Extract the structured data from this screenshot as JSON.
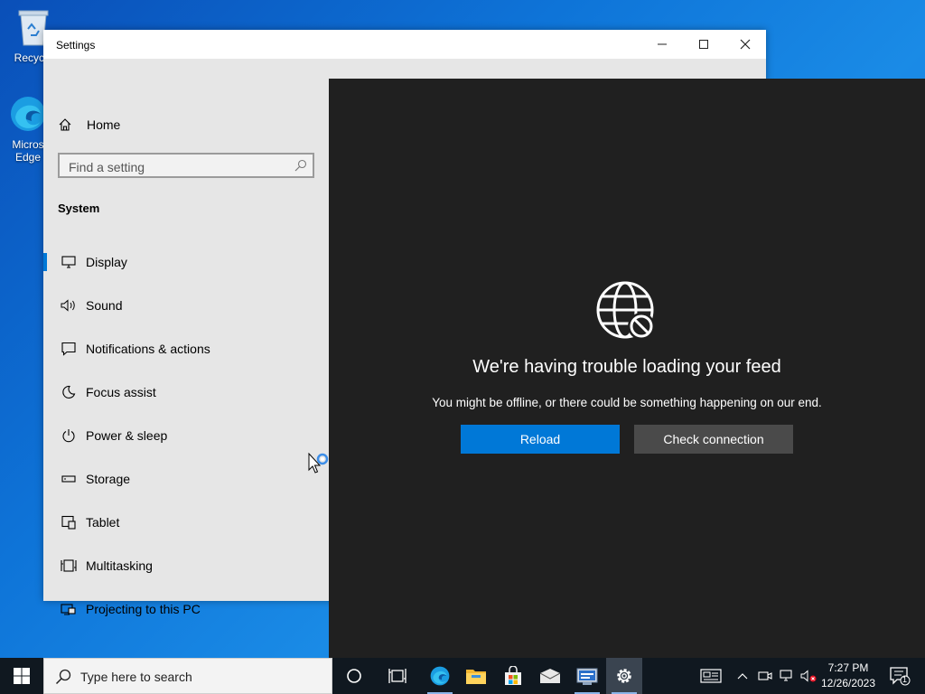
{
  "desktop": {
    "icons": [
      {
        "label": "Recycle"
      },
      {
        "label": "Microsoft Edge",
        "label_line1": "Micros",
        "label_line2": "Edge"
      }
    ]
  },
  "window": {
    "title": "Settings",
    "controls": {
      "minimize": "minimize-icon",
      "maximize": "maximize-icon",
      "close": "close-icon"
    }
  },
  "sidebar": {
    "home_label": "Home",
    "search_placeholder": "Find a setting",
    "section_title": "System",
    "items": [
      {
        "label": "Display",
        "icon": "display-icon",
        "active": true
      },
      {
        "label": "Sound",
        "icon": "sound-icon"
      },
      {
        "label": "Notifications & actions",
        "icon": "notifications-icon"
      },
      {
        "label": "Focus assist",
        "icon": "moon-icon"
      },
      {
        "label": "Power & sleep",
        "icon": "power-icon"
      },
      {
        "label": "Storage",
        "icon": "storage-icon"
      },
      {
        "label": "Tablet",
        "icon": "tablet-icon"
      },
      {
        "label": "Multitasking",
        "icon": "multitasking-icon"
      },
      {
        "label": "Projecting to this PC",
        "icon": "projecting-icon"
      }
    ]
  },
  "feed": {
    "icon": "globe-blocked-icon",
    "title": "We're having trouble loading your feed",
    "subtitle": "You might be offline, or there could be something happening on our end.",
    "reload_label": "Reload",
    "check_label": "Check connection"
  },
  "taskbar": {
    "search_placeholder": "Type here to search",
    "time": "7:27 PM",
    "date": "12/26/2023",
    "notification_count": "1"
  },
  "colors": {
    "accent": "#0078d7",
    "feed_bg": "#202020",
    "sidebar_bg": "#e6e6e6",
    "taskbar_bg": "#101820"
  }
}
